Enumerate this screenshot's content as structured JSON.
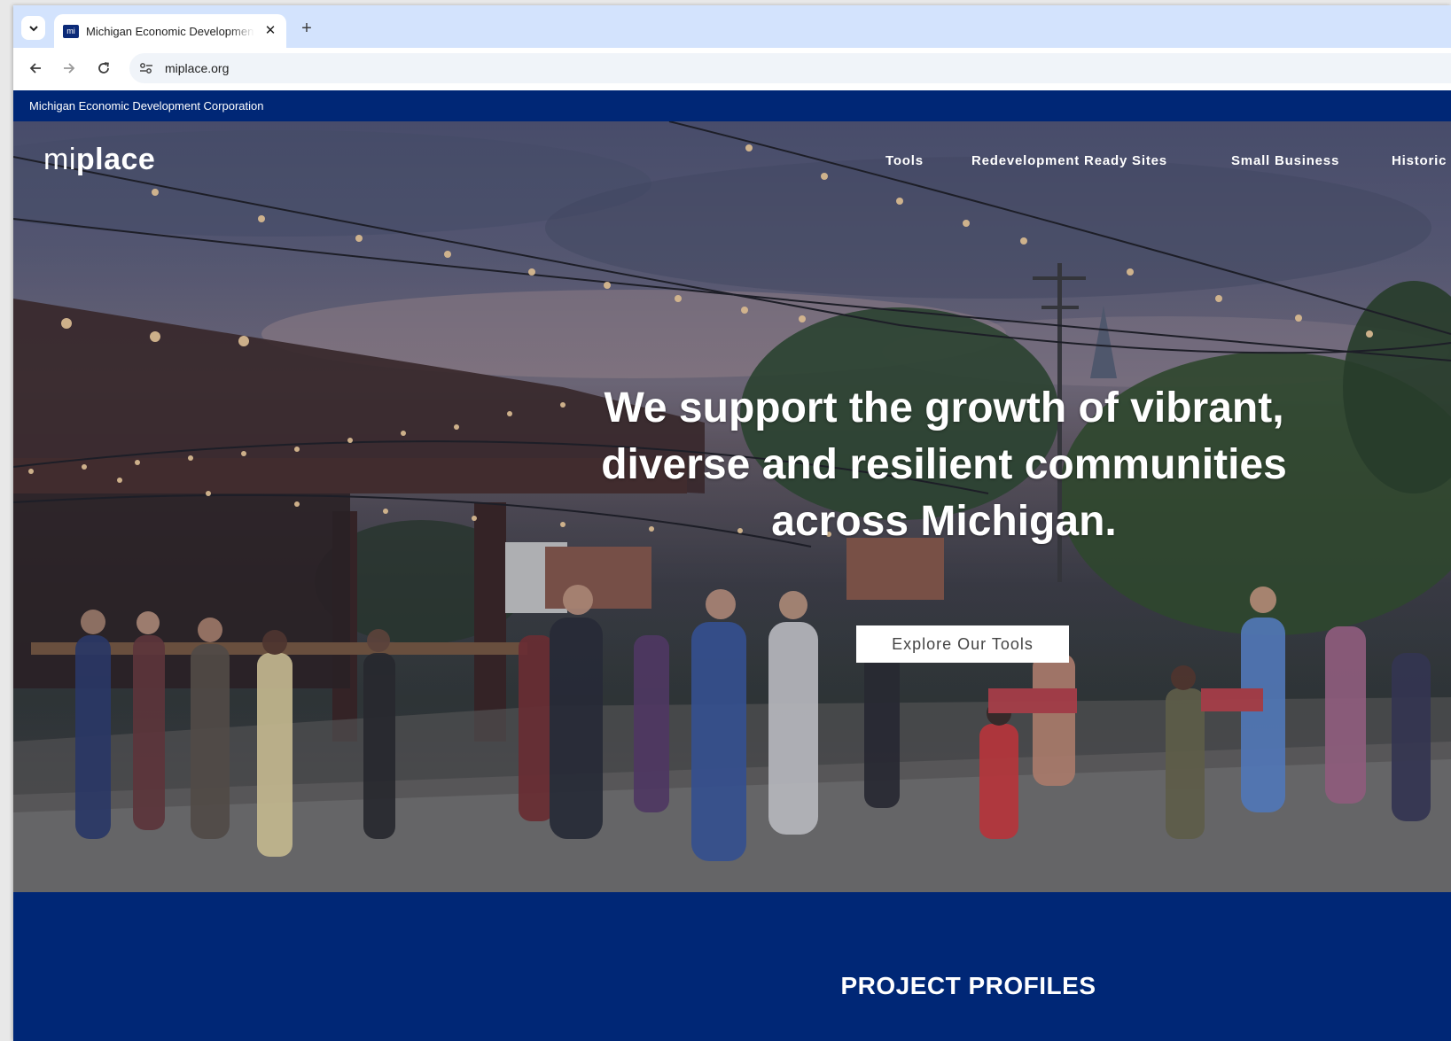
{
  "browser": {
    "tab_title": "Michigan Economic Development Corporation",
    "favicon_text": "mi",
    "url": "miplace.org"
  },
  "topbar": {
    "org_name": "Michigan Economic Development Corporation"
  },
  "logo": {
    "mi": "mi",
    "place": "place"
  },
  "nav": {
    "items": [
      "Tools",
      "Redevelopment Ready Sites",
      "Small Business",
      "Historic"
    ]
  },
  "hero": {
    "headline": "We support the growth of vibrant, diverse and resilient communities across Michigan.",
    "cta_label": "Explore Our Tools"
  },
  "profiles": {
    "title": "PROJECT PROFILES"
  },
  "colors": {
    "brand_navy": "#002776",
    "tabstrip": "#d3e3fd",
    "omnibox": "#f0f4f9"
  }
}
